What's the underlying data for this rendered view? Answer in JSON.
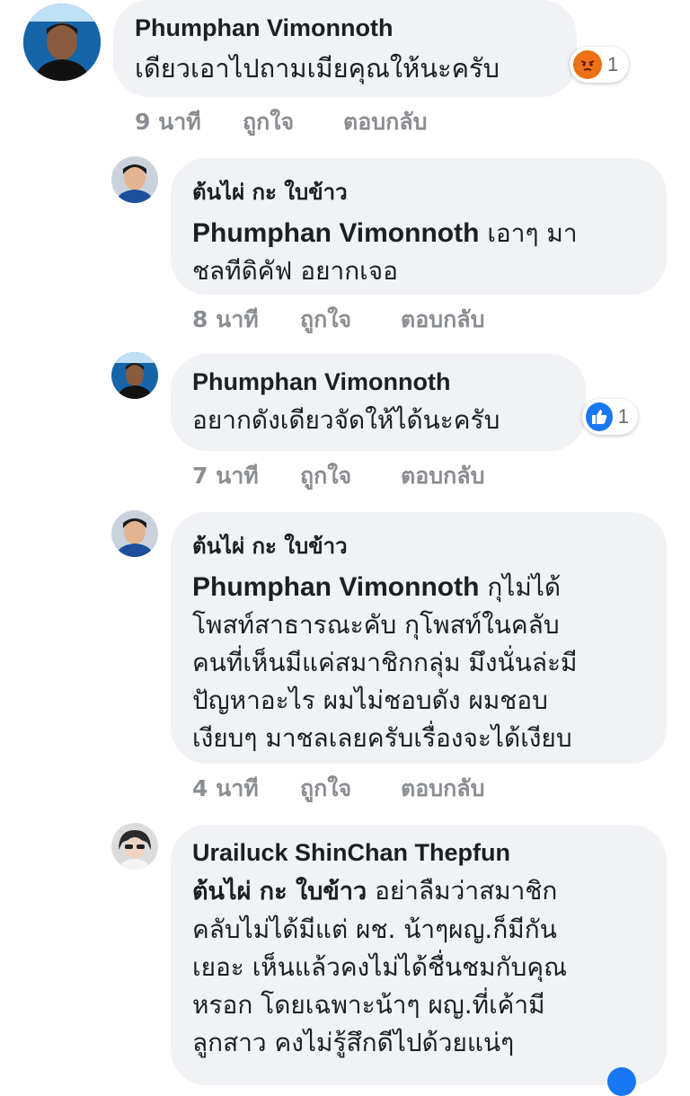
{
  "labels": {
    "like": "ถูกใจ",
    "reply": "ตอบกลับ"
  },
  "comments": [
    {
      "author": "Phumphan Vimonnoth",
      "text": "เดียวเอาไปถามเมียคุณให้นะครับ",
      "time": "9 นาที",
      "reaction": {
        "type": "angry-icon",
        "count": "1"
      }
    },
    {
      "author": "ต้นไผ่ กะ ใบข้าว",
      "mention": "Phumphan Vimonnoth",
      "text_line1": "เอาๆ มา",
      "text_line2": "ชลทีดิคัฟ อยากเจอ",
      "time": "8 นาที"
    },
    {
      "author": "Phumphan Vimonnoth",
      "text": "อยากดังเดียวจัดให้ได้นะครับ",
      "time": "7 นาที",
      "reaction": {
        "type": "like-icon",
        "count": "1"
      }
    },
    {
      "author": "ต้นไผ่ กะ ใบข้าว",
      "mention": "Phumphan Vimonnoth",
      "text_line1": "กุไม่ได้",
      "lines": [
        "โพสท์สาธารณะคับ กุโพสท์ในคลับ",
        "คนที่เห็นมีแค่สมาชิกกลุ่ม มึงนั่นล่ะมี",
        "ปัญหาอะไร ผมไม่ชอบดัง ผมชอบ",
        "เงียบๆ มาชลเลยครับเรื่องจะได้เงียบ"
      ],
      "time": "4 นาที"
    },
    {
      "author": "Urailuck ShinChan Thepfun",
      "mention": "ต้นไผ่ กะ ใบข้าว",
      "text_line1": "อย่าลืมว่าสมาชิก",
      "lines": [
        "คลับไม่ได้มีแต่ ผช. น้าๆผญ.ก็มีกัน",
        "เยอะ เห็นแล้วคงไม่ได้ชื่นชมกับคุณ",
        "หรอก โดยเฉพาะน้าๆ ผญ.ที่เค้ามี",
        "ลูกสาว คงไม่รู้สึกดีไปด้วยแน่ๆ"
      ]
    }
  ],
  "colors": {
    "bubble": "#f0f2f5",
    "meta": "#8a8d91",
    "like_blue": "#1877f2",
    "angry_orange": "#e9710f"
  }
}
